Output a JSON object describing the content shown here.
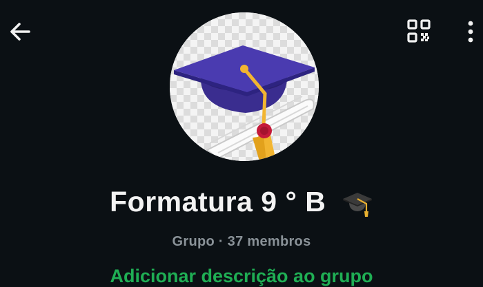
{
  "header": {
    "back_icon": "arrow-left-icon",
    "qr_icon": "qr-code-icon",
    "menu_icon": "more-vertical-icon"
  },
  "profile": {
    "avatar_icon": "graduation-cap-image",
    "name": "Formatura 9 ° B",
    "name_emoji_icon": "graduation-cap-icon",
    "meta": "Grupo · 37 membros",
    "add_description": "Adicionar descrição ao grupo"
  },
  "colors": {
    "background": "#0b1014",
    "accent_green": "#1fae54",
    "text_primary": "#f3f3f3",
    "text_secondary": "#8a9298"
  }
}
